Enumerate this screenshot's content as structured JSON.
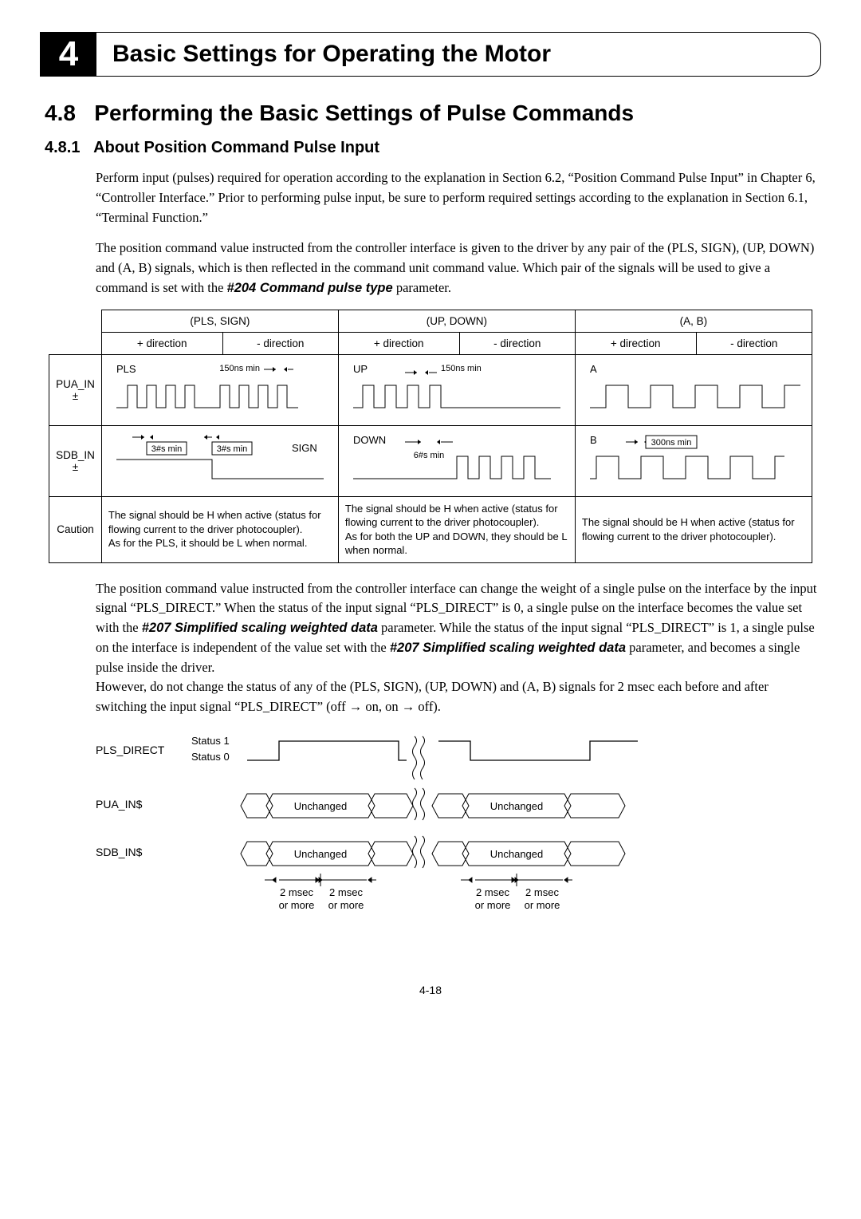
{
  "chapter": {
    "num": "4",
    "title": "Basic Settings for Operating the Motor"
  },
  "section": {
    "num": "4.8",
    "title": "Performing the Basic Settings of Pulse Commands"
  },
  "subsection": {
    "num": "4.8.1",
    "title": "About Position Command Pulse Input"
  },
  "p1a": "Perform input (pulses) required for operation according to the explanation in Section 6.2, “Position Command Pulse Input” in Chapter 6, “Controller Interface.” Prior to performing pulse input, be sure to perform required settings according to the explanation in Section 6.1, “Terminal Function.”",
  "p2a": "The position command value instructed from the controller interface is given to the driver by any pair of the (PLS, SIGN), (UP, DOWN) and (A, B) signals, which is then reflected in the command unit command value. Which pair of the signals will be used to give a command is set with the ",
  "p2param": "#204 Command pulse type",
  "p2b": " parameter.",
  "tbl": {
    "col_pls_sign": "(PLS, SIGN)",
    "col_up_down": "(UP, DOWN)",
    "col_ab": "(A, B)",
    "plus_dir": "+ direction",
    "minus_dir": "- direction",
    "row_pua": "PUA_IN\n±",
    "row_sdb": "SDB_IN\n±",
    "row_caution": "Caution",
    "pls": "PLS",
    "up": "UP",
    "a": "A",
    "b": "B",
    "sign": "SIGN",
    "down": "DOWN",
    "t150": "150ns min",
    "t3s": "3#s min",
    "t6s": "6#s min",
    "t300": "300ns min",
    "caution_pls": "The signal should be H when active (status for flowing current to the driver photocoupler).\nAs for the PLS, it should be L when normal.",
    "caution_updown": "The signal should be H when active (status for flowing current to the driver photocoupler).\nAs for both the UP and DOWN, they should be L when normal.",
    "caution_ab": "The signal should be H when active (status for flowing current to the driver photocoupler)."
  },
  "p3a": "The position command value instructed from the controller interface can change the weight of a single pulse on the interface by the input signal “PLS_DIRECT.” When the status of the input signal “PLS_DIRECT” is 0, a single pulse on the interface becomes the value set with the ",
  "p3param1": "#207 Simplified scaling weighted data",
  "p3b": " parameter. While the status of the input signal “PLS_DIRECT” is 1, a single pulse on the interface is independent of the value set with the ",
  "p3param2": "#207 Simplified scaling weighted data",
  "p3c": " parameter, and becomes a single pulse inside the driver.",
  "p3d": "However, do not change the status of any of the (PLS, SIGN), (UP, DOWN) and (A, B) signals for 2 msec each before and after switching the input signal “PLS_DIRECT” (off → on, on → off).",
  "timing": {
    "pls_direct": "PLS_DIRECT",
    "pua_ins": "PUA_IN$",
    "sdb_ins": "SDB_IN$",
    "status1": "Status 1",
    "status0": "Status 0",
    "unchanged": "Unchanged",
    "two_a": "2 msec",
    "two_b": "2 msec",
    "or_more": "or more"
  },
  "page": "4-18"
}
